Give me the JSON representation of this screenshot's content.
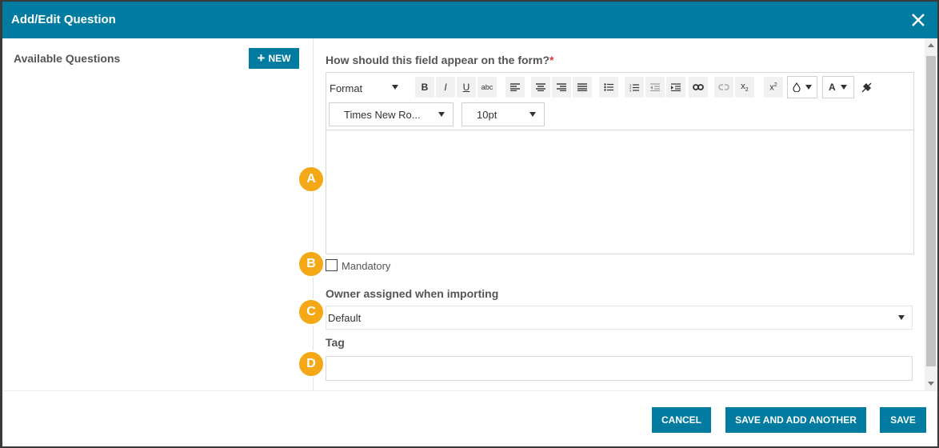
{
  "dialog": {
    "title": "Add/Edit Question",
    "close_icon": "close-icon"
  },
  "left": {
    "available_label": "Available Questions",
    "new_label": "NEW",
    "new_icon": "plus-icon"
  },
  "form": {
    "appear_label": "How should this field appear on the form?",
    "required_mark": "*",
    "toolbar": {
      "format_label": "Format",
      "font_label": "Times New Ro...",
      "size_label": "10pt",
      "buttons": [
        "bold-icon",
        "italic-icon",
        "underline-icon",
        "strikethrough-icon",
        "align-left-icon",
        "align-center-icon",
        "align-right-icon",
        "align-justify-icon",
        "bullet-list-icon",
        "numbered-list-icon",
        "outdent-icon",
        "indent-icon",
        "link-icon",
        "unlink-icon",
        "subscript-icon",
        "superscript-icon",
        "fill-color-icon",
        "font-color-icon",
        "clear-format-icon"
      ]
    },
    "mandatory_label": "Mandatory",
    "owner_label": "Owner assigned when importing",
    "owner_value": "Default",
    "tag_label": "Tag",
    "tag_value": "",
    "badges": [
      "A",
      "B",
      "C",
      "D"
    ]
  },
  "footer": {
    "cancel_label": "CANCEL",
    "save_another_label": "SAVE AND ADD ANOTHER",
    "save_label": "SAVE"
  },
  "colors": {
    "primary": "#017b9f",
    "badge": "#f5a816",
    "required": "#d43b3b"
  }
}
